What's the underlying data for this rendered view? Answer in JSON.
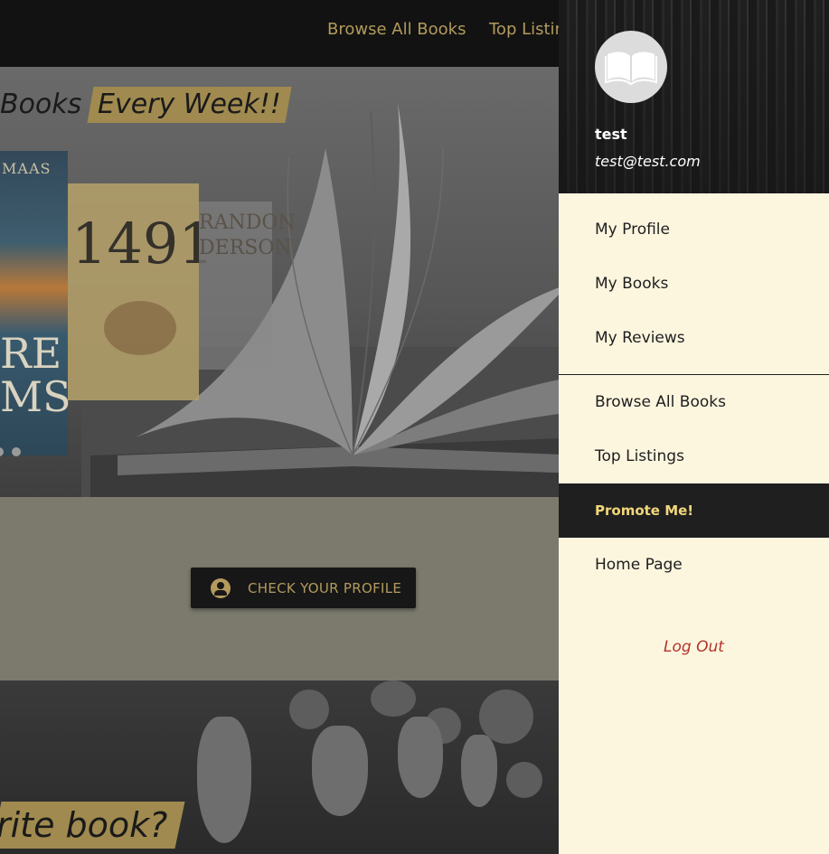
{
  "topnav": {
    "browse": "Browse All Books",
    "top_listings": "Top Listin"
  },
  "hero": {
    "banner_text": "Books",
    "banner_highlight": "Every Week!!",
    "covers": {
      "cover1_author": "MAAS",
      "cover1_title": "RE\nMS",
      "cover2_title": "1491",
      "cover3_title": "RANDON\nDERSON"
    }
  },
  "cta": {
    "icon": "account-circle-icon",
    "label": "CHECK YOUR PROFILE"
  },
  "lower": {
    "banner_text": "rite book?"
  },
  "drawer": {
    "avatar_icon": "open-book-icon",
    "user_name": "test",
    "user_email": "test@test.com",
    "menu_top": [
      {
        "label": "My Profile"
      },
      {
        "label": "My Books"
      },
      {
        "label": "My Reviews"
      }
    ],
    "menu_bottom": [
      {
        "label": "Browse All Books"
      },
      {
        "label": "Top Listings"
      },
      {
        "label": "Promote Me!"
      },
      {
        "label": "Home Page"
      }
    ],
    "logout": "Log Out"
  },
  "colors": {
    "accent_gold": "#b39a5d",
    "drawer_bg": "#fdf6df",
    "active_bg": "#1f1f1f",
    "active_text": "#f2d77a",
    "logout_red": "#b3332b"
  }
}
